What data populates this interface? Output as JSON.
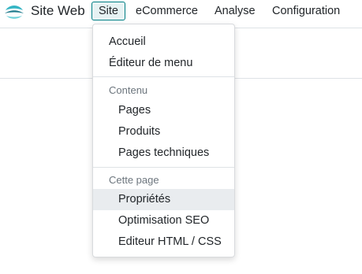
{
  "app": {
    "name": "Site Web",
    "logo_icon": "website-app-logo-icon"
  },
  "navbar": {
    "items": [
      {
        "label": "Site",
        "active": true
      },
      {
        "label": "eCommerce"
      },
      {
        "label": "Analyse"
      },
      {
        "label": "Configuration"
      }
    ]
  },
  "dropdown": {
    "items": [
      {
        "label": "Accueil"
      },
      {
        "label": "Éditeur de menu"
      }
    ],
    "sections": [
      {
        "header": "Contenu",
        "items": [
          {
            "label": "Pages"
          },
          {
            "label": "Produits"
          },
          {
            "label": "Pages techniques"
          }
        ]
      },
      {
        "header": "Cette page",
        "items": [
          {
            "label": "Propriétés",
            "highlighted": true
          },
          {
            "label": "Optimisation SEO"
          },
          {
            "label": "Editeur HTML / CSS"
          }
        ]
      }
    ]
  },
  "colors": {
    "accent": "#017e84",
    "active_bg": "#e6f2f3",
    "hover_bg": "#e9ecef",
    "header_text": "#6c757d"
  }
}
